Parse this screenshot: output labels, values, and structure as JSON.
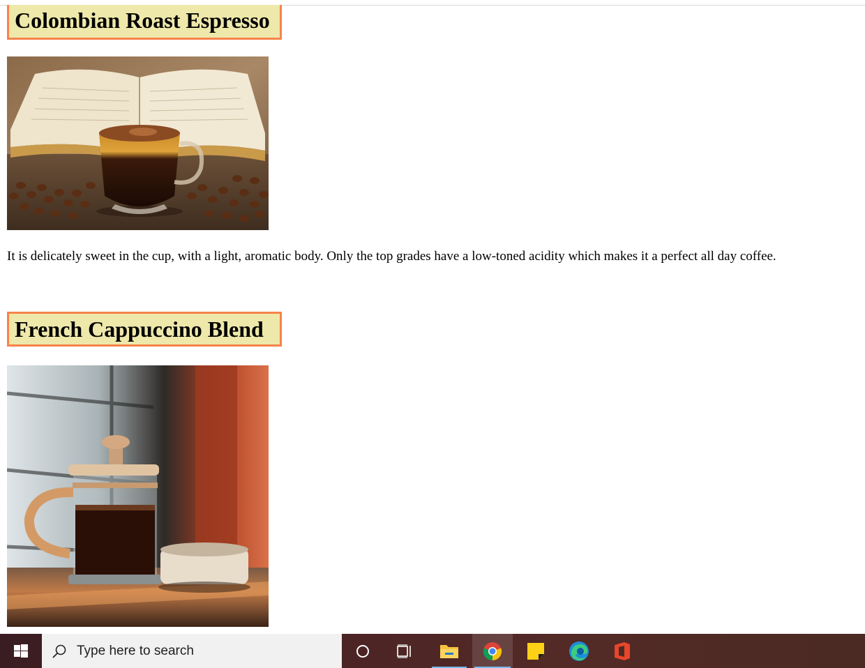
{
  "products": [
    {
      "title": "Colombian Roast Espresso",
      "image": "espresso-cup-with-open-book-and-coffee-beans",
      "description": "It is delicately sweet in the cup, with a light, aromatic body. Only the top grades have a low-toned acidity which makes it a perfect all day coffee."
    },
    {
      "title": "French Cappuccino Blend",
      "image": "french-press-coffee-maker-with-cup"
    }
  ],
  "colors": {
    "title_background": "#eee8aa",
    "title_border": "#f7834a"
  },
  "taskbar": {
    "search_placeholder": "Type here to search",
    "icons": [
      "windows-start-icon",
      "search-icon",
      "cortana-icon",
      "task-view-icon",
      "file-explorer-icon",
      "chrome-icon",
      "sticky-notes-icon",
      "edge-icon",
      "office-icon"
    ]
  }
}
